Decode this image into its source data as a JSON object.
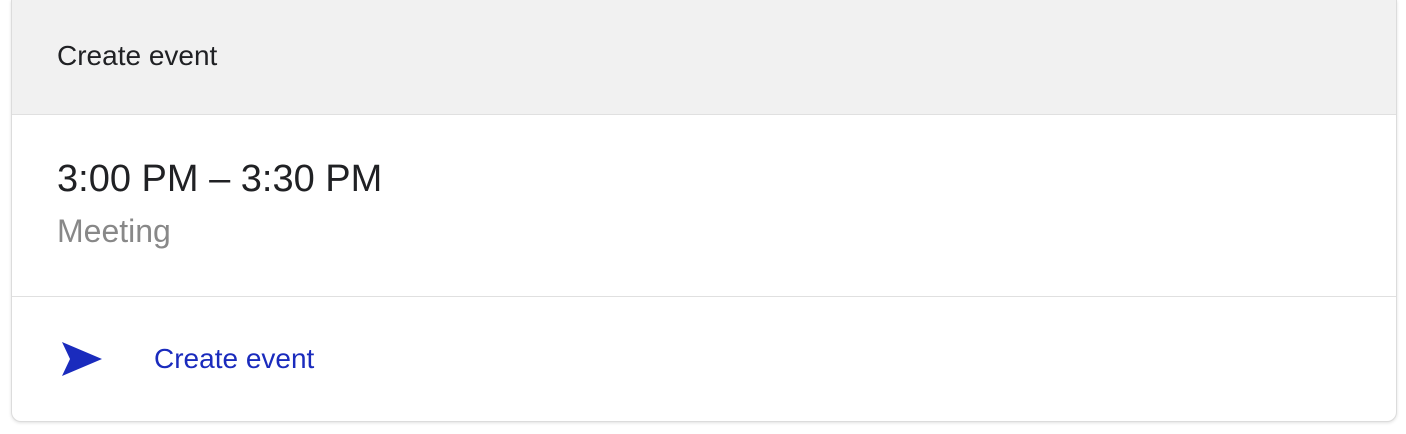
{
  "header": {
    "title": "Create event"
  },
  "event": {
    "time_range": "3:00 PM – 3:30 PM",
    "type": "Meeting"
  },
  "action": {
    "icon": "send-icon",
    "label": "Create event",
    "color": "#1a2bbd"
  }
}
